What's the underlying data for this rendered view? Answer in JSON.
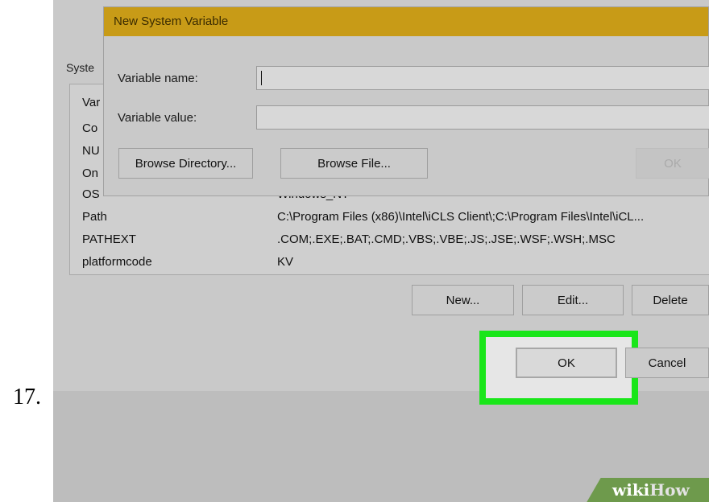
{
  "step_number": "17.",
  "dialog": {
    "title": "New System Variable",
    "variable_name_label": "Variable name:",
    "variable_name_value": "",
    "variable_value_label": "Variable value:",
    "variable_value_value": "",
    "browse_directory_label": "Browse Directory...",
    "browse_file_label": "Browse File...",
    "ok_label": "OK"
  },
  "background_panel": {
    "section_label": "Syste",
    "list_header_fragment": "Var",
    "rows": [
      {
        "name": "Co",
        "value": ""
      },
      {
        "name": "NU",
        "value": ""
      },
      {
        "name": "On",
        "value": ""
      },
      {
        "name": "OS",
        "value": "Windows_NT"
      },
      {
        "name": "Path",
        "value": "C:\\Program Files (x86)\\Intel\\iCLS Client\\;C:\\Program Files\\Intel\\iCL..."
      },
      {
        "name": "PATHEXT",
        "value": ".COM;.EXE;.BAT;.CMD;.VBS;.VBE;.JS;.JSE;.WSF;.WSH;.MSC"
      },
      {
        "name": "platformcode",
        "value": "KV"
      }
    ],
    "new_label": "New...",
    "edit_label": "Edit...",
    "delete_label": "Delete"
  },
  "footer_buttons": {
    "ok_label": "OK",
    "cancel_label": "Cancel"
  },
  "watermark": {
    "part1": "wiki",
    "part2": "How"
  },
  "colors": {
    "titlebar": "#c89b17",
    "highlight": "#19e619"
  }
}
